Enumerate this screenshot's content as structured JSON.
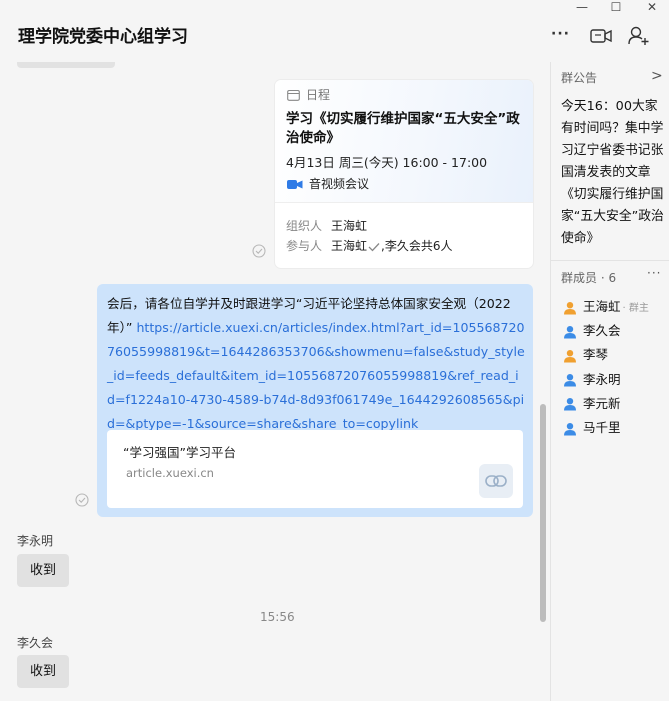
{
  "window": {
    "controls": [
      "—",
      "☐",
      "✕"
    ]
  },
  "header": {
    "title": "理学院党委中心组学习",
    "icons": [
      "more-icon",
      "video-icon",
      "add-member-icon"
    ],
    "more_glyph": "···"
  },
  "schedule_card": {
    "label": "日程",
    "title": "学习《切实履行维护国家“五大安全”政治使命》",
    "time": "4月13日 周三(今天) 16:00 - 17:00",
    "meeting": "音视频会议",
    "organizer_label": "组织人",
    "organizer": "王海虹",
    "participants_label": "参与人",
    "participants_name": "王海虹",
    "participants_rest": ",李久会共6人"
  },
  "message": {
    "text_prefix": "会后，请各位自学并及时跟进学习“习近平论坚持总体国家安全观（2022年）”",
    "url": "https://article.xuexi.cn/articles/index.html?art_id=10556872076055998819&t=1644286353706&showmenu=false&study_style_id=feeds_default&item_id=10556872076055998819&ref_read_id=f1224a10-4730-4589-b74d-8d93f061749e_1644292608565&pid=&ptype=-1&source=share&share_to=copylink",
    "link_card": {
      "title": "“学习强国”学习平台",
      "domain": "article.xuexi.cn"
    }
  },
  "replies": [
    {
      "sender": "李永明",
      "text": "收到"
    },
    {
      "sender": "李久会",
      "text": "收到"
    }
  ],
  "timestamp": "15:56",
  "side_panel": {
    "notice_header": "群公告",
    "notice_arrow": ">",
    "notice_text": "今天16：00大家有时间吗？集中学习辽宁省委书记张国清发表的文章《切实履行维护国家“五大安全”政治使命》",
    "members_header": "群成员 · 6",
    "members_more": "···",
    "members": [
      {
        "name": "王海虹",
        "tag": "· 群主",
        "color": "#f0a030"
      },
      {
        "name": "李久会",
        "tag": "",
        "color": "#3c8ce6"
      },
      {
        "name": "李琴",
        "tag": "",
        "color": "#f0a030"
      },
      {
        "name": "李永明",
        "tag": "",
        "color": "#3c8ce6"
      },
      {
        "name": "李元新",
        "tag": "",
        "color": "#3c8ce6"
      },
      {
        "name": "马千里",
        "tag": "",
        "color": "#3c8ce6"
      }
    ]
  },
  "colors": {
    "bubble": "#cde3fb",
    "link": "#2a6fd8",
    "accent": "#3c8ce6"
  }
}
